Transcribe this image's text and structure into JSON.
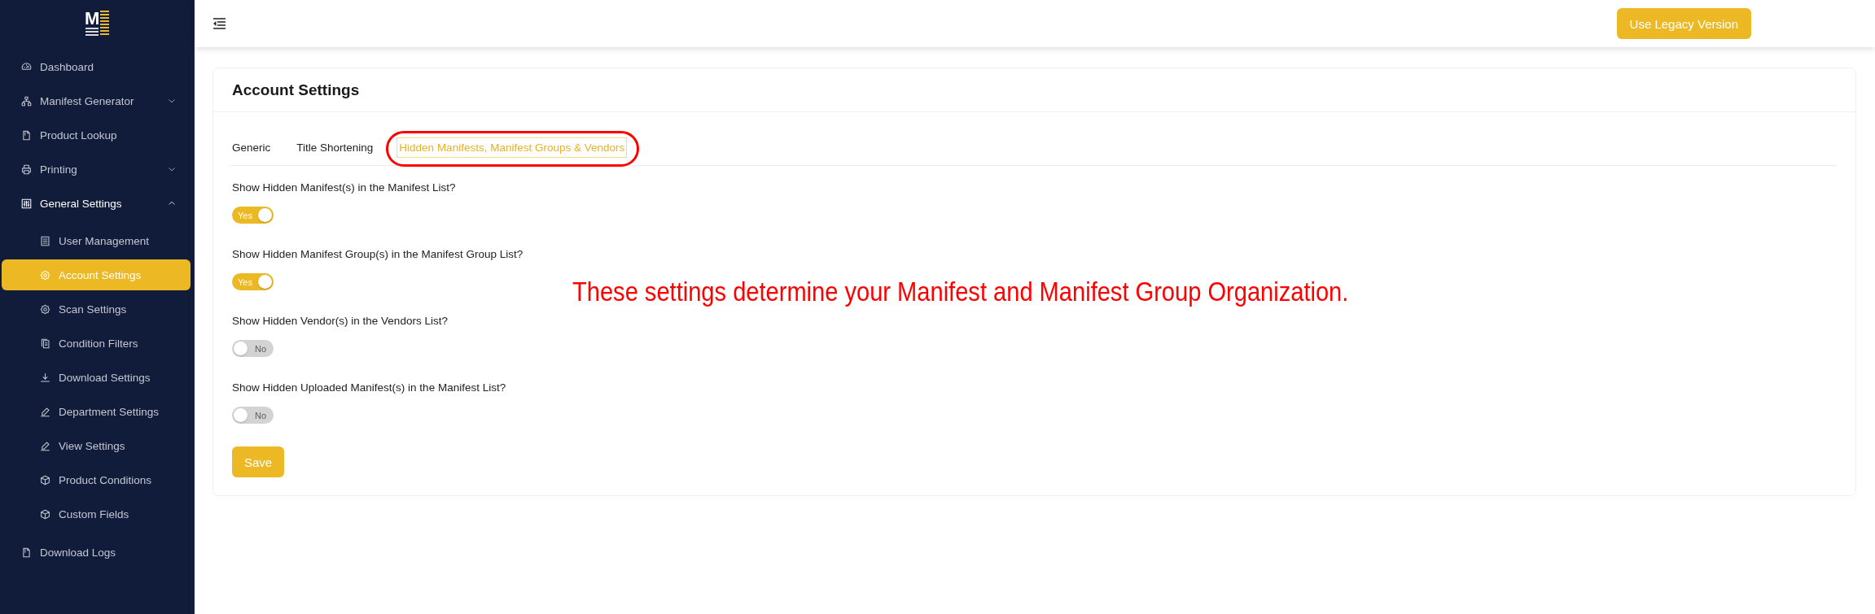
{
  "logo": {
    "text": "M"
  },
  "sidebar": {
    "items": [
      {
        "label": "Dashboard",
        "kind": "link",
        "selected": false
      },
      {
        "label": "Manifest Generator",
        "kind": "group",
        "expanded": false,
        "selected": false
      },
      {
        "label": "Product Lookup",
        "kind": "link",
        "selected": false
      },
      {
        "label": "Printing",
        "kind": "group",
        "expanded": false,
        "selected": false
      },
      {
        "label": "General Settings",
        "kind": "group",
        "expanded": true,
        "selected": false,
        "children": [
          {
            "label": "User Management",
            "selected": false
          },
          {
            "label": "Account Settings",
            "selected": true
          },
          {
            "label": "Scan Settings",
            "selected": false
          },
          {
            "label": "Condition Filters",
            "selected": false
          },
          {
            "label": "Download Settings",
            "selected": false
          },
          {
            "label": "Department Settings",
            "selected": false
          },
          {
            "label": "View Settings",
            "selected": false
          },
          {
            "label": "Product Conditions",
            "selected": false
          },
          {
            "label": "Custom Fields",
            "selected": false
          }
        ]
      },
      {
        "label": "Download Logs",
        "kind": "link",
        "selected": false
      }
    ]
  },
  "header": {
    "legacy_button": "Use Legacy Version"
  },
  "card": {
    "title": "Account Settings",
    "tabs": [
      {
        "label": "Generic",
        "selected": false,
        "circled": false
      },
      {
        "label": "Title Shortening",
        "selected": false,
        "circled": false
      },
      {
        "label": "Hidden Manifests, Manifest Groups & Vendors",
        "selected": true,
        "circled": true
      }
    ],
    "settings": [
      {
        "label": "Show Hidden Manifest(s) in the Manifest List?",
        "on": true,
        "state_text": "Yes"
      },
      {
        "label": "Show Hidden Manifest Group(s) in the Manifest Group List?",
        "on": true,
        "state_text": "Yes"
      },
      {
        "label": "Show Hidden Vendor(s) in the Vendors List?",
        "on": false,
        "state_text": "No"
      },
      {
        "label": "Show Hidden Uploaded Manifest(s) in the Manifest List?",
        "on": false,
        "state_text": "No"
      }
    ],
    "save_button": "Save"
  },
  "annotation": {
    "text": "These settings determine your Manifest and Manifest Group Organization."
  }
}
